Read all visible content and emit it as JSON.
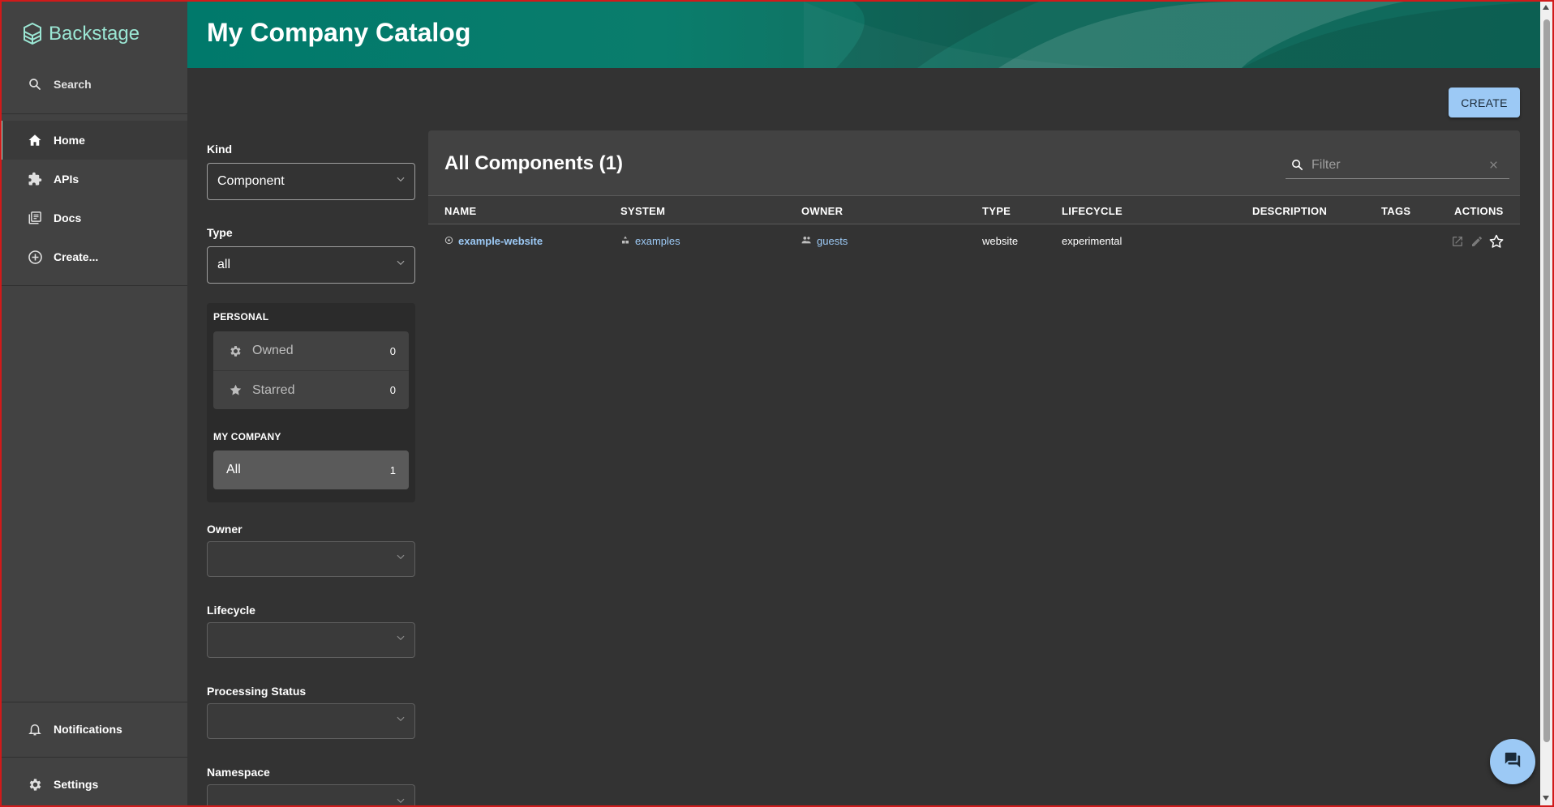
{
  "app": {
    "name": "Backstage"
  },
  "sidebar": {
    "search_label": "Search",
    "items": [
      {
        "label": "Home",
        "icon": "home-icon",
        "active": true
      },
      {
        "label": "APIs",
        "icon": "puzzle-icon",
        "active": false
      },
      {
        "label": "Docs",
        "icon": "docs-icon",
        "active": false
      },
      {
        "label": "Create...",
        "icon": "add-circle-icon",
        "active": false
      }
    ],
    "notifications_label": "Notifications",
    "settings_label": "Settings"
  },
  "header": {
    "title": "My Company Catalog"
  },
  "toolbar": {
    "create_label": "CREATE"
  },
  "filters": {
    "kind": {
      "label": "Kind",
      "value": "Component"
    },
    "type": {
      "label": "Type",
      "value": "all"
    },
    "personal": {
      "title": "PERSONAL",
      "owned": {
        "label": "Owned",
        "count": "0"
      },
      "starred": {
        "label": "Starred",
        "count": "0"
      }
    },
    "company": {
      "title": "MY COMPANY",
      "all": {
        "label": "All",
        "count": "1"
      }
    },
    "owner": {
      "label": "Owner",
      "value": ""
    },
    "lifecycle": {
      "label": "Lifecycle",
      "value": ""
    },
    "processing_status": {
      "label": "Processing Status",
      "value": ""
    },
    "namespace": {
      "label": "Namespace",
      "value": ""
    }
  },
  "table": {
    "title": "All Components (1)",
    "filter_placeholder": "Filter",
    "columns": [
      "NAME",
      "SYSTEM",
      "OWNER",
      "TYPE",
      "LIFECYCLE",
      "DESCRIPTION",
      "TAGS",
      "ACTIONS"
    ],
    "rows": [
      {
        "name": "example-website",
        "system": "examples",
        "owner": "guests",
        "type": "website",
        "lifecycle": "experimental",
        "description": "",
        "tags": ""
      }
    ]
  },
  "colors": {
    "accent": "#9be7d4",
    "primary": "#9cc9f5",
    "header": "#00796b",
    "background": "#333333",
    "sidebar": "#424242"
  }
}
